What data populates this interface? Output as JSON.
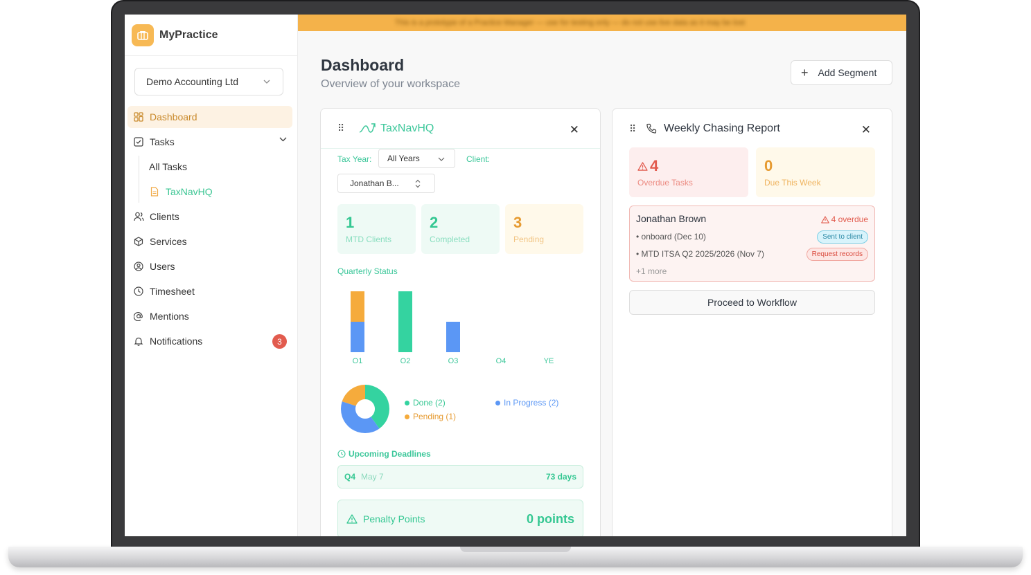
{
  "app": {
    "name": "MyPractice"
  },
  "sidebar": {
    "org": "Demo Accounting Ltd",
    "items": [
      {
        "label": "Dashboard"
      },
      {
        "label": "Tasks"
      },
      {
        "label": "All Tasks"
      },
      {
        "label": "TaxNavHQ"
      },
      {
        "label": "Clients"
      },
      {
        "label": "Services"
      },
      {
        "label": "Users"
      },
      {
        "label": "Timesheet"
      },
      {
        "label": "Mentions"
      },
      {
        "label": "Notifications",
        "badge": "3"
      }
    ]
  },
  "banner": {
    "text": "This is a prototype of a Practice Manager — use for testing only — do not use live data as it may be lost"
  },
  "header": {
    "title": "Dashboard",
    "subtitle": "Overview of your workspace",
    "add_segment": "Add Segment"
  },
  "taxnav": {
    "title": "TaxNavHQ",
    "tax_year_label": "Tax Year:",
    "tax_year_value": "All Years",
    "client_label": "Client:",
    "client_value": "Jonathan B...",
    "stats": [
      {
        "value": "1",
        "label": "MTD Clients"
      },
      {
        "value": "2",
        "label": "Completed"
      },
      {
        "value": "3",
        "label": "Pending"
      }
    ],
    "quarterly_label": "Quarterly Status",
    "upcoming_label": "Upcoming Deadlines",
    "deadline": {
      "quarter": "Q4",
      "date": "May 7",
      "days": "73 days"
    },
    "penalty": {
      "label": "Penalty Points",
      "value": "0 points"
    }
  },
  "chart_data": [
    {
      "type": "bar",
      "categories": [
        "Q1",
        "Q2",
        "Q3",
        "Q4",
        "YE"
      ],
      "series": [
        {
          "name": "Done",
          "values": [
            0,
            2,
            0,
            0,
            0
          ],
          "color": "#34d3a0"
        },
        {
          "name": "In Progress",
          "values": [
            1,
            0,
            1,
            0,
            0
          ],
          "color": "#5b97f5"
        },
        {
          "name": "Pending",
          "values": [
            1,
            0,
            0,
            0,
            0
          ],
          "color": "#f5ab3c"
        }
      ],
      "ylim": [
        0,
        2
      ]
    },
    {
      "type": "pie",
      "labels": [
        "Done (2)",
        "In Progress (2)",
        "Pending (1)"
      ],
      "values": [
        2,
        2,
        1
      ],
      "colors": [
        "#34d3a0",
        "#5b97f5",
        "#f5ab3c"
      ]
    }
  ],
  "chasing": {
    "title": "Weekly Chasing Report",
    "overdue_count": "4",
    "overdue_label": "Overdue Tasks",
    "due_count": "0",
    "due_label": "Due This Week",
    "client_name": "Jonathan Brown",
    "client_overdue": "4 overdue",
    "tasks": [
      {
        "text": "• onboard (Dec 10)",
        "status": "Sent to client"
      },
      {
        "text": "• MTD ITSA Q2 2025/2026 (Nov 7)",
        "status": "Request records"
      }
    ],
    "more": "+1 more",
    "proceed": "Proceed to Workflow"
  }
}
